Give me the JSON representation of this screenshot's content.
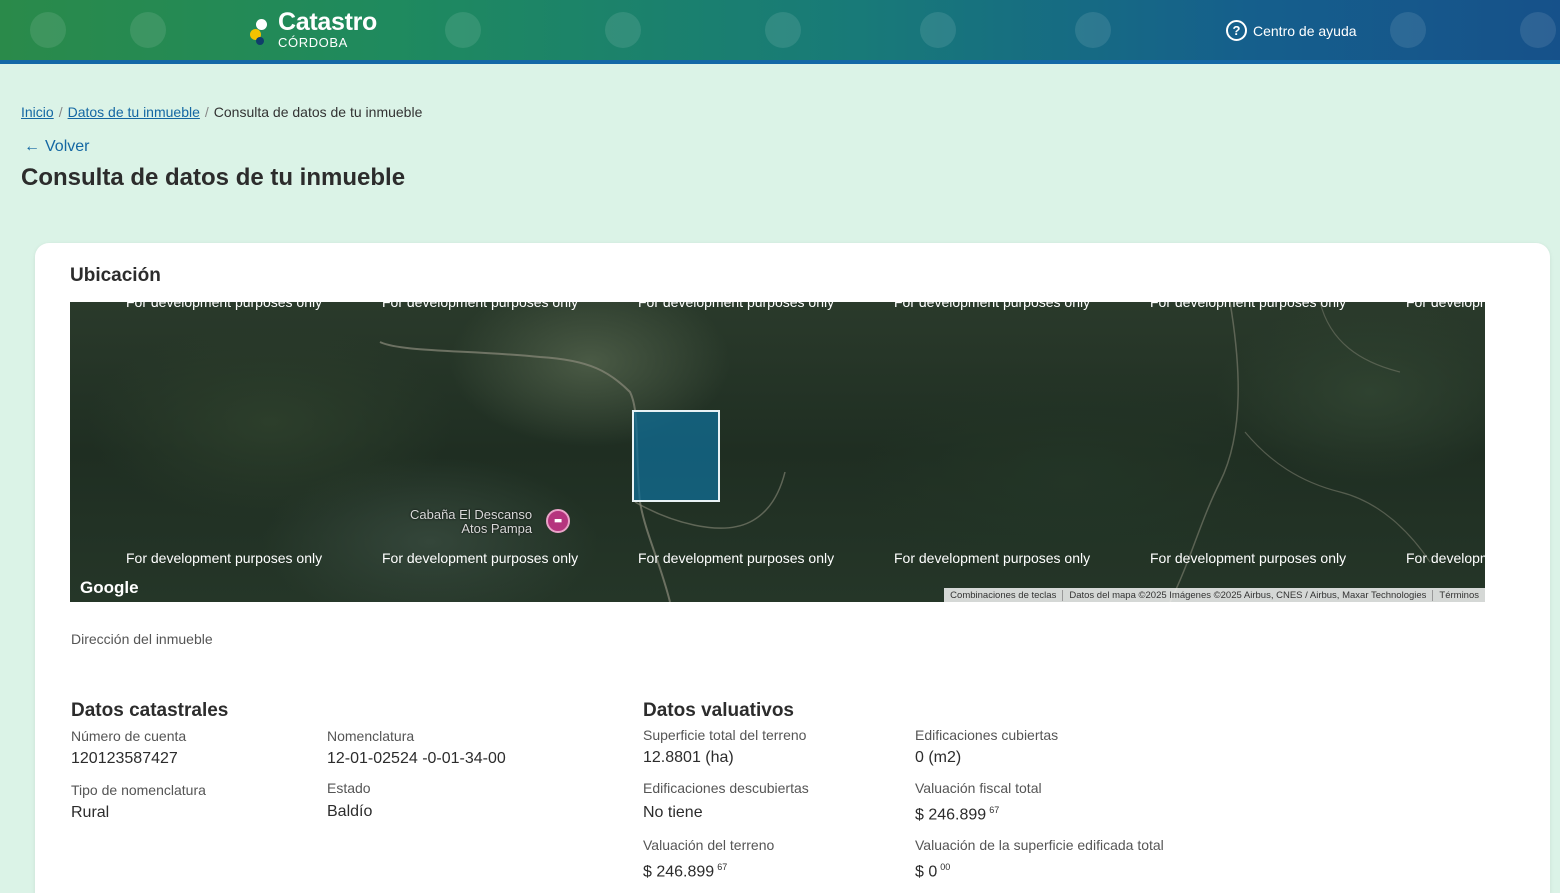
{
  "header": {
    "logo_title": "Catastro",
    "logo_subtitle": "CÓRDOBA",
    "help_label": "Centro de ayuda",
    "help_icon": "question-circle-icon"
  },
  "breadcrumb": {
    "items": [
      "Inicio",
      "Datos de tu inmueble"
    ],
    "current": "Consulta de datos de tu inmueble",
    "separator": "/"
  },
  "back_label": "Volver",
  "page_title": "Consulta de datos de tu inmueble",
  "ubicacion": {
    "title": "Ubicación",
    "map": {
      "watermark": "For development purposes only",
      "poi_line1": "Cabaña El Descanso",
      "poi_line2": "Atos Pampa",
      "google_logo": "Google",
      "attribution": [
        "Combinaciones de teclas",
        "Datos del mapa ©2025 Imágenes ©2025 Airbus, CNES / Airbus, Maxar Technologies",
        "Términos"
      ],
      "parcel_color": "#106e96"
    },
    "direccion_label": "Dirección del inmueble"
  },
  "datos_catastrales": {
    "title": "Datos catastrales",
    "numero_cuenta_label": "Número de cuenta",
    "numero_cuenta": "120123587427",
    "nomenclatura_label": "Nomenclatura",
    "nomenclatura": "12-01-02524 -0-01-34-00",
    "tipo_label": "Tipo de nomenclatura",
    "tipo": "Rural",
    "estado_label": "Estado",
    "estado": "Baldío"
  },
  "datos_valuativos": {
    "title": "Datos valuativos",
    "superficie_label": "Superficie total del terreno",
    "superficie": "12.8801 (ha)",
    "cubiertas_label": "Edificaciones cubiertas",
    "cubiertas": "0 (m2)",
    "descubiertas_label": "Edificaciones descubiertas",
    "descubiertas": "No tiene",
    "fiscal_label": "Valuación fiscal total",
    "fiscal_main": "$ 246.899",
    "fiscal_cents": "67",
    "terreno_label": "Valuación del terreno",
    "terreno_main": "$ 246.899",
    "terreno_cents": "67",
    "edificada_label": "Valuación de la superficie edificada total",
    "edificada_main": "$ 0",
    "edificada_cents": "00"
  }
}
